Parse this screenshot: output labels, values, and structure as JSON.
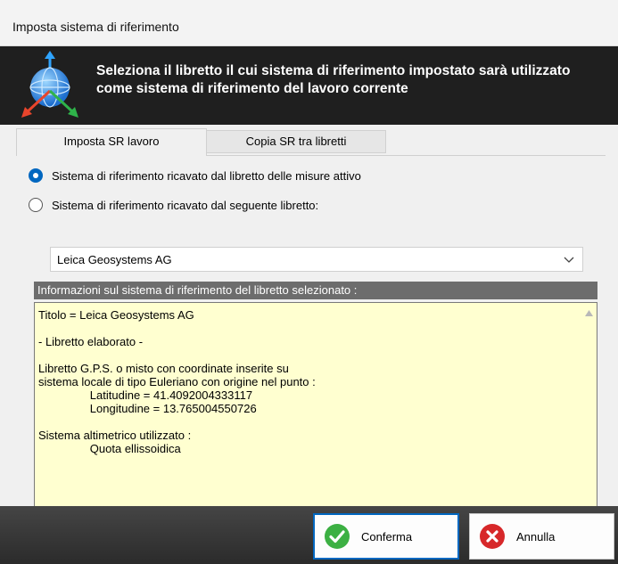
{
  "window": {
    "title": "Imposta sistema di riferimento"
  },
  "header": {
    "message": "Seleziona il libretto il cui sistema di riferimento impostato sarà utilizzato come sistema di riferimento del lavoro corrente",
    "icon": "globe-axes-icon"
  },
  "tabs": [
    {
      "label": "Imposta SR lavoro",
      "active": true
    },
    {
      "label": "Copia SR tra libretti",
      "active": false
    }
  ],
  "options": {
    "active_booklet": {
      "label": "Sistema di riferimento ricavato dal libretto delle misure attivo",
      "checked": true
    },
    "following_booklet": {
      "label": "Sistema di riferimento ricavato dal seguente libretto:",
      "checked": false
    }
  },
  "booklet_select": {
    "value": "Leica Geosystems AG"
  },
  "info": {
    "header": "Informazioni sul sistema di riferimento del libretto selezionato :",
    "text": "Titolo = Leica Geosystems AG\n\n- Libretto elaborato -\n\nLibretto G.P.S. o misto con coordinate inserite su\nsistema locale di tipo Euleriano con origine nel punto :\n\t\tLatitudine = 41.4092004333117\n\t\tLongitudine = 13.765004550726\n\nSistema altimetrico utilizzato :\n\t\tQuota ellissoidica"
  },
  "buttons": {
    "confirm": "Conferma",
    "cancel": "Annulla"
  },
  "colors": {
    "header_bg": "#1f1f1f",
    "accent": "#0067c0",
    "info_bg": "#ffffd0",
    "confirm_green": "#3cb043",
    "cancel_red": "#d7282a"
  }
}
